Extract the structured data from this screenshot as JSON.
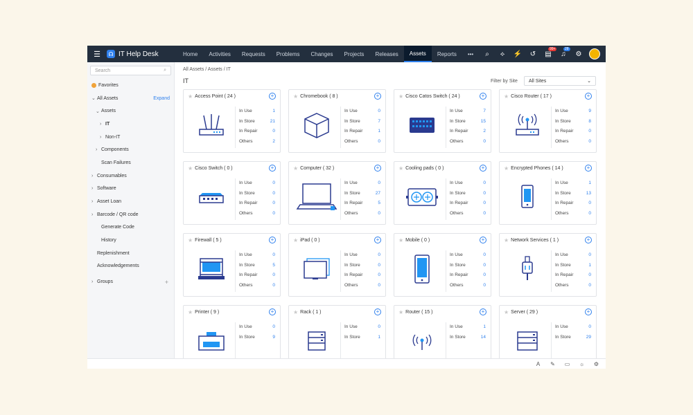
{
  "header": {
    "brand": "IT Help Desk",
    "nav": [
      "Home",
      "Activities",
      "Requests",
      "Problems",
      "Changes",
      "Projects",
      "Releases",
      "Assets",
      "Reports",
      "•••"
    ],
    "active_nav": "Assets",
    "badges": {
      "requests": "99+",
      "notifications": "28"
    }
  },
  "sidebar": {
    "search_placeholder": "Search",
    "favorites": "Favorites",
    "all_assets": "All Assets",
    "expand": "Expand",
    "items": [
      {
        "label": "Assets",
        "indent": 1,
        "chev": "⌄"
      },
      {
        "label": "IT",
        "indent": 2,
        "chev": "›",
        "bold": true
      },
      {
        "label": "Non-IT",
        "indent": 2,
        "chev": "›"
      },
      {
        "label": "Components",
        "indent": 1,
        "chev": "›"
      },
      {
        "label": "Scan Failures",
        "indent": 1,
        "chev": ""
      },
      {
        "label": "Consumables",
        "indent": 0,
        "chev": "›"
      },
      {
        "label": "Software",
        "indent": 0,
        "chev": "›"
      },
      {
        "label": "Asset Loan",
        "indent": 0,
        "chev": "›"
      },
      {
        "label": "Barcode / QR code",
        "indent": 0,
        "chev": "›"
      },
      {
        "label": "Generate Code",
        "indent": 1,
        "chev": ""
      },
      {
        "label": "History",
        "indent": 1,
        "chev": ""
      },
      {
        "label": "Replenishment",
        "indent": 0,
        "chev": ""
      },
      {
        "label": "Acknowledgements",
        "indent": 0,
        "chev": ""
      }
    ],
    "groups": "Groups"
  },
  "main": {
    "breadcrumb": "All Assets  /  Assets  /  IT",
    "title": "IT",
    "filter_label": "Filter by Site",
    "filter_value": "All Sites",
    "stat_labels": [
      "In Use",
      "In Store",
      "In Repair",
      "Others"
    ],
    "cards": [
      {
        "name": "Access Point ( 24 )",
        "icon": "access-point-icon",
        "stats": [
          "1",
          "21",
          "0",
          "2"
        ]
      },
      {
        "name": "Chromebook ( 8 )",
        "icon": "chromebook-icon",
        "stats": [
          "0",
          "7",
          "1",
          "0"
        ]
      },
      {
        "name": "Cisco Catos Switch ( 24 )",
        "icon": "switch-icon",
        "stats": [
          "7",
          "15",
          "2",
          "0"
        ]
      },
      {
        "name": "Cisco Router ( 17 )",
        "icon": "router-icon",
        "stats": [
          "9",
          "8",
          "0",
          "0"
        ]
      },
      {
        "name": "Cisco Switch ( 0 )",
        "icon": "switch-small-icon",
        "stats": [
          "0",
          "0",
          "0",
          "0"
        ]
      },
      {
        "name": "Computer ( 32 )",
        "icon": "computer-icon",
        "stats": [
          "0",
          "27",
          "5",
          "0"
        ]
      },
      {
        "name": "Cooling pads ( 0 )",
        "icon": "cooling-pad-icon",
        "stats": [
          "0",
          "0",
          "0",
          "0"
        ]
      },
      {
        "name": "Encrypted Phones ( 14 )",
        "icon": "phone-icon",
        "stats": [
          "1",
          "13",
          "0",
          "0"
        ]
      },
      {
        "name": "Firewall ( 5 )",
        "icon": "firewall-icon",
        "stats": [
          "0",
          "5",
          "0",
          "0"
        ]
      },
      {
        "name": "iPad ( 0 )",
        "icon": "ipad-icon",
        "stats": [
          "0",
          "0",
          "0",
          "0"
        ]
      },
      {
        "name": "Mobile ( 0 )",
        "icon": "mobile-icon",
        "stats": [
          "0",
          "0",
          "0",
          "0"
        ]
      },
      {
        "name": "Network Services ( 1 )",
        "icon": "network-cable-icon",
        "stats": [
          "0",
          "1",
          "0",
          "0"
        ]
      },
      {
        "name": "Printer ( 9 )",
        "icon": "printer-icon",
        "stats": [
          "0",
          "9",
          "",
          ""
        ]
      },
      {
        "name": "Rack ( 1 )",
        "icon": "rack-icon",
        "stats": [
          "0",
          "1",
          "",
          ""
        ]
      },
      {
        "name": "Router ( 15 )",
        "icon": "router-wireless-icon",
        "stats": [
          "1",
          "14",
          "",
          ""
        ]
      },
      {
        "name": "Server ( 29 )",
        "icon": "server-icon",
        "stats": [
          "0",
          "29",
          "",
          ""
        ]
      }
    ]
  },
  "colors": {
    "accent": "#2f80ed",
    "topbar": "#232f3e",
    "icon": "#2a3a8f",
    "icon_fill": "#2196f3"
  }
}
